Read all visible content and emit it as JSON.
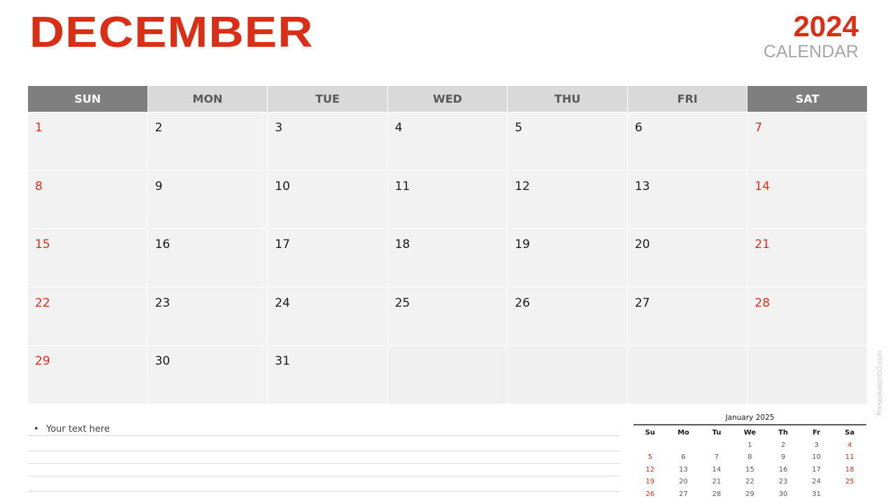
{
  "header": {
    "month": "DECEMBER",
    "year": "2024",
    "subtitle": "CALENDAR"
  },
  "colors": {
    "accent": "#d92f17",
    "weekend_header_bg": "#7f7f7f",
    "weekday_header_bg": "#d9d9d9",
    "cell_bg": "#f2f2f2"
  },
  "weekdays": [
    "SUN",
    "MON",
    "TUE",
    "WED",
    "THU",
    "FRI",
    "SAT"
  ],
  "weeks": [
    [
      "1",
      "2",
      "3",
      "4",
      "5",
      "6",
      "7"
    ],
    [
      "8",
      "9",
      "10",
      "11",
      "12",
      "13",
      "14"
    ],
    [
      "15",
      "16",
      "17",
      "18",
      "19",
      "20",
      "21"
    ],
    [
      "22",
      "23",
      "24",
      "25",
      "26",
      "27",
      "28"
    ],
    [
      "29",
      "30",
      "31",
      "",
      "",
      "",
      ""
    ]
  ],
  "notes": {
    "bullet": "•",
    "items": [
      "Your text here"
    ]
  },
  "mini_calendar": {
    "title": "January 2025",
    "weekdays": [
      "Su",
      "Mo",
      "Tu",
      "We",
      "Th",
      "Fr",
      "Sa"
    ],
    "weeks": [
      [
        "",
        "",
        "",
        "1",
        "2",
        "3",
        "4"
      ],
      [
        "5",
        "6",
        "7",
        "8",
        "9",
        "10",
        "11"
      ],
      [
        "12",
        "13",
        "14",
        "15",
        "16",
        "17",
        "18"
      ],
      [
        "19",
        "20",
        "21",
        "22",
        "23",
        "24",
        "25"
      ],
      [
        "26",
        "27",
        "28",
        "29",
        "30",
        "31",
        ""
      ]
    ]
  },
  "watermark": "PresentationGO.com"
}
